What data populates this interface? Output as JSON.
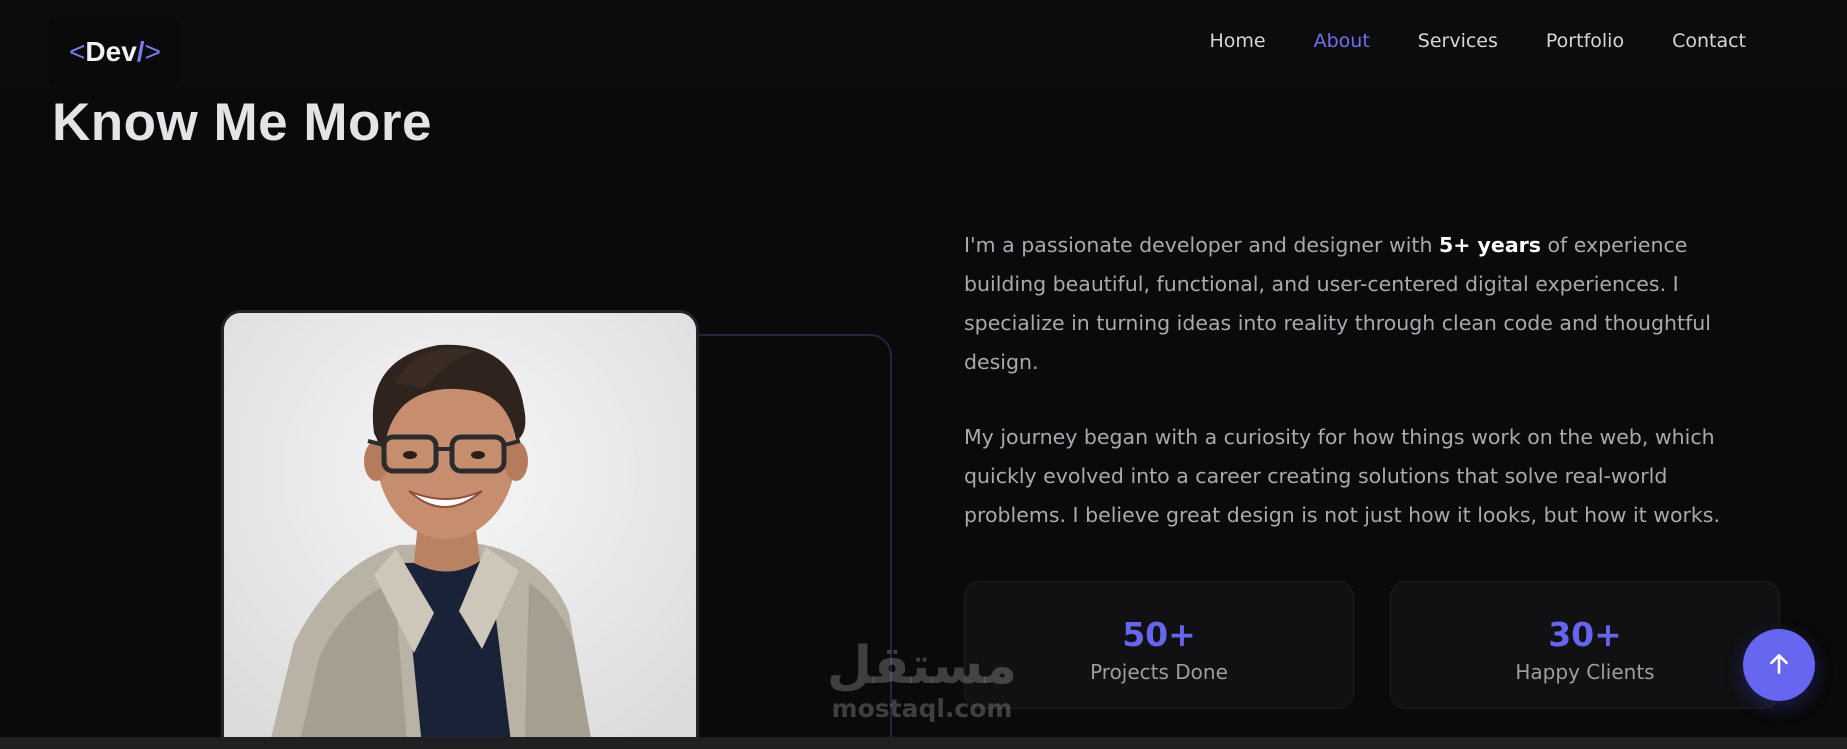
{
  "navbar": {
    "logo": {
      "open": "<",
      "text": "Dev",
      "slash": "/",
      "close": ">"
    },
    "links": [
      "Home",
      "About",
      "Services",
      "Portfolio",
      "Contact"
    ],
    "active_link": "About"
  },
  "section": {
    "title": "Know Me More"
  },
  "about": {
    "para1_before": "I'm a passionate developer and designer with ",
    "para1_highlight": "5+ years",
    "para1_after": " of experience building beautiful, functional, and user-centered digital experiences. I specialize in turning ideas into reality through clean code and thoughtful design.",
    "para2": "My journey began with a curiosity for how things work on the web, which quickly evolved into a career creating solutions that solve real-world problems. I believe great design is not just how it looks, but how it works."
  },
  "stats": [
    {
      "value": "50+",
      "label": "Projects Done"
    },
    {
      "value": "30+",
      "label": "Happy Clients"
    }
  ],
  "watermark": {
    "arabic": "مستقل",
    "latin": "mostaql.com"
  },
  "colors": {
    "accent": "#6666f0",
    "background": "#0a0a0b",
    "text_muted": "#a9a9ae"
  },
  "icons": {
    "scroll_top": "arrow-up-icon"
  }
}
